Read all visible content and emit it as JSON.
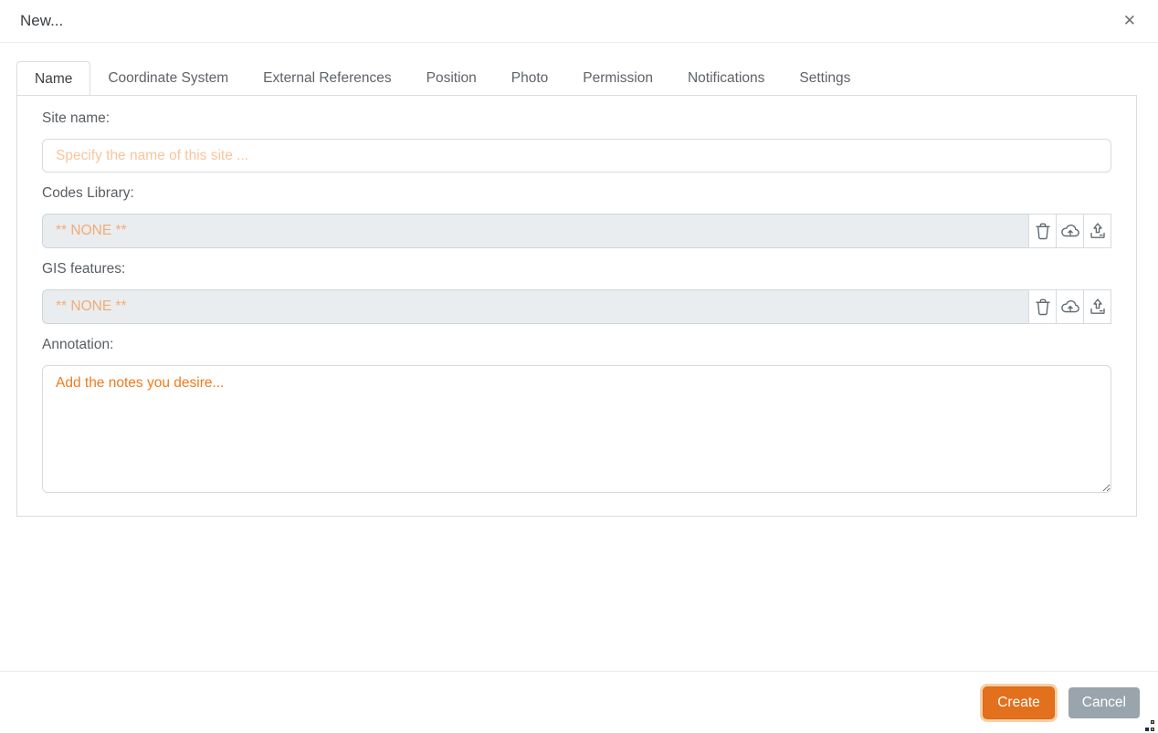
{
  "dialog": {
    "title": "New...",
    "close_glyph": "✕"
  },
  "tabs": [
    {
      "label": "Name",
      "active": true
    },
    {
      "label": "Coordinate System",
      "active": false
    },
    {
      "label": "External References",
      "active": false
    },
    {
      "label": "Position",
      "active": false
    },
    {
      "label": "Photo",
      "active": false
    },
    {
      "label": "Permission",
      "active": false
    },
    {
      "label": "Notifications",
      "active": false
    },
    {
      "label": "Settings",
      "active": false
    }
  ],
  "form": {
    "site_name": {
      "label": "Site name:",
      "value": "",
      "placeholder": "Specify the name of this site ..."
    },
    "codes_library": {
      "label": "Codes Library:",
      "value": "** NONE **",
      "buttons": [
        "delete",
        "cloud-upload",
        "upload-file"
      ]
    },
    "gis_features": {
      "label": "GIS features:",
      "value": "** NONE **",
      "buttons": [
        "delete",
        "cloud-upload",
        "upload-file"
      ]
    },
    "annotation": {
      "label": "Annotation:",
      "value": "",
      "placeholder": "Add the notes you desire..."
    }
  },
  "footer": {
    "create_label": "Create",
    "cancel_label": "Cancel"
  },
  "colors": {
    "accent_orange": "#e2701c",
    "focus_ring_orange": "#f6cfa8",
    "placeholder_light_orange": "#f8c59d",
    "placeholder_strong_orange": "#ef7a1d",
    "readonly_value_orange": "#f4ab74",
    "readonly_bg": "#e9edf0",
    "cancel_gray": "#9aa4ad",
    "panel_border": "#d9dde0"
  }
}
